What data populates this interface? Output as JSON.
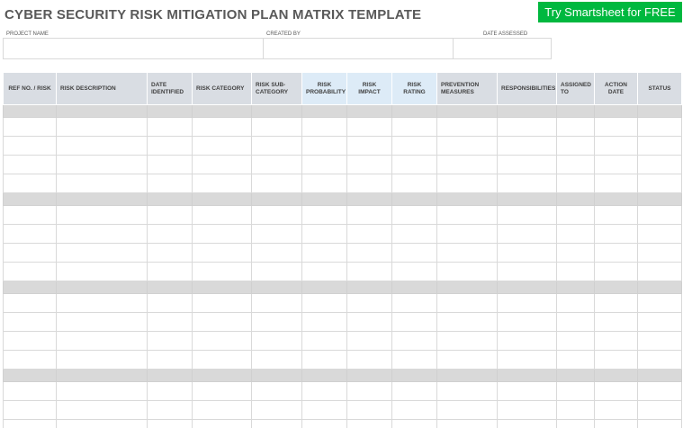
{
  "title": "CYBER SECURITY RISK MITIGATION PLAN MATRIX TEMPLATE",
  "cta": {
    "label": "Try Smartsheet for FREE",
    "color": "#00b83f"
  },
  "meta": {
    "project_name_label": "PROJECT NAME",
    "created_by_label": "CREATED BY",
    "date_assessed_label": "DATE ASSESSED"
  },
  "table": {
    "columns": [
      "REF NO. / RISK",
      "RISK DESCRIPTION",
      "DATE IDENTIFIED",
      "RISK CATEGORY",
      "RISK SUB-CATEGORY",
      "RISK PROBABILITY",
      "RISK IMPACT",
      "RISK RATING",
      "PREVENTION MEASURES",
      "RESPONSIBILITIES",
      "ASSIGNED TO",
      "ACTION DATE",
      "STATUS"
    ],
    "header_color": "#d9dde3",
    "highlight_header_color": "#ddebf7",
    "group_row_color": "#d9d9d9"
  }
}
